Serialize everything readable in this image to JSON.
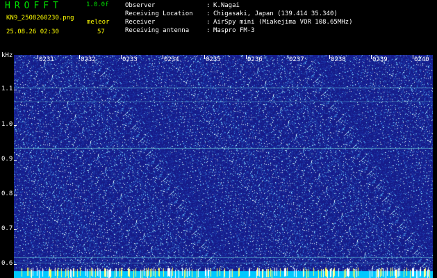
{
  "header": {
    "app_title": "HROFFT",
    "version": "1.0.0f",
    "filename": "KN9_2508260230.png",
    "mode_label": "meleor",
    "datetime": "25.08.26 02:30",
    "count": "57"
  },
  "station_info": [
    {
      "label": "Observer",
      "value": "K.Nagai"
    },
    {
      "label": "Receiving Location",
      "value": "Chigasaki, Japan (139.414 35.340)"
    },
    {
      "label": "Receiver",
      "value": "AirSpy mini (Miakejima VOR 108.65MHz)"
    },
    {
      "label": "Receiving antenna",
      "value": "Maspro FM-3"
    }
  ],
  "spectrogram": {
    "y_unit": "kHz",
    "y_ticks": [
      "1.1",
      "1.0",
      "0.9",
      "0.8",
      "0.7",
      "0.6"
    ],
    "x_ticks": [
      "0231",
      "0232",
      "0233",
      "0234",
      "0235",
      "0236",
      "0237",
      "0238",
      "0239",
      "0240"
    ],
    "colors": {
      "background": "#1a1f8f",
      "noise_high": "#5fd0ff",
      "signal_line": "#6fe0e0",
      "baseline": "#00c8ff"
    }
  }
}
